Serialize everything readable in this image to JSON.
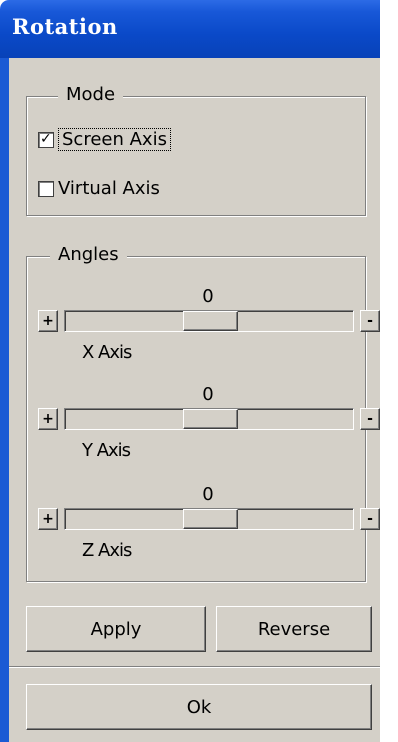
{
  "window": {
    "title": "Rotation"
  },
  "mode": {
    "legend": "Mode",
    "screen_axis": {
      "label": "Screen Axis",
      "checked": true
    },
    "virtual_axis": {
      "label": "Virtual Axis",
      "checked": false
    }
  },
  "angles": {
    "legend": "Angles",
    "x": {
      "value": "0",
      "label": "X Axis",
      "plus": "+",
      "minus": "-"
    },
    "y": {
      "value": "0",
      "label": "Y Axis",
      "plus": "+",
      "minus": "-"
    },
    "z": {
      "value": "0",
      "label": "Z Axis",
      "plus": "+",
      "minus": "-"
    }
  },
  "buttons": {
    "apply": "Apply",
    "reverse": "Reverse",
    "ok": "Ok"
  },
  "colors": {
    "titlebar": "#0a49c8",
    "dialog_bg": "#d4d0c8"
  }
}
